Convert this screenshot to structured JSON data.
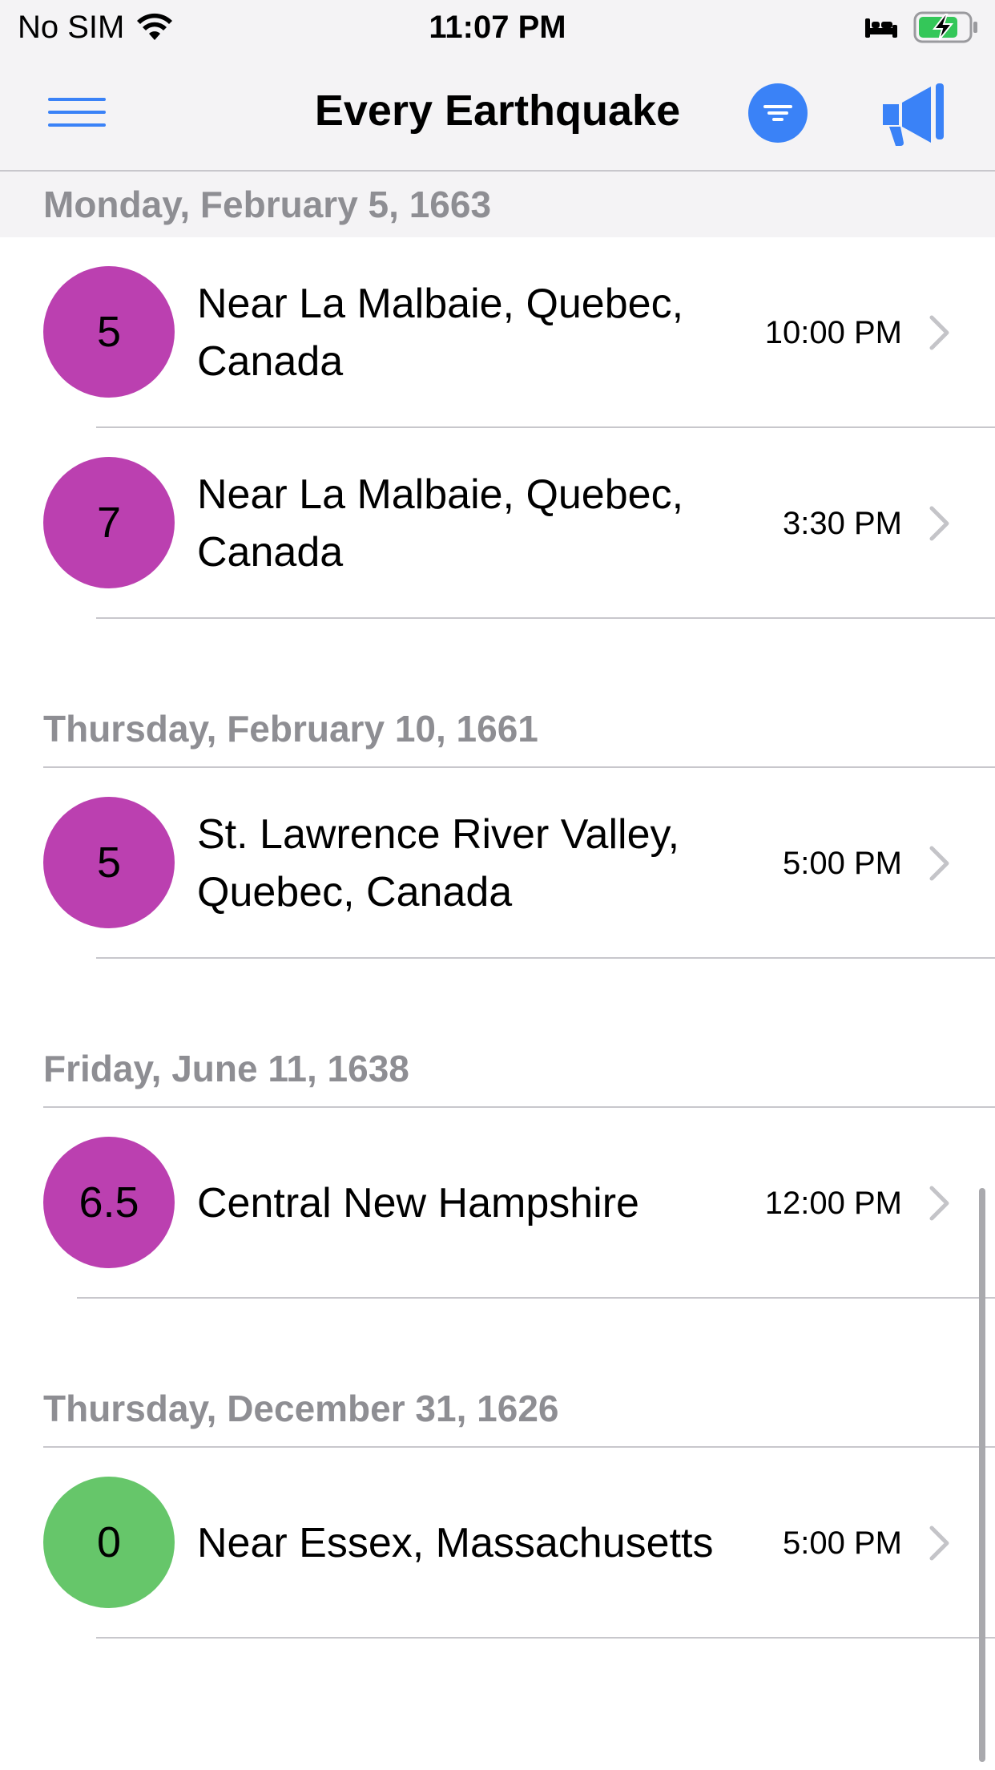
{
  "status_bar": {
    "carrier": "No SIM",
    "time": "11:07 PM"
  },
  "nav": {
    "title": "Every Earthquake",
    "accent_color": "#3a82f7"
  },
  "sections": [
    {
      "date": "Monday, February 5, 1663",
      "items": [
        {
          "magnitude": "5",
          "place": "Near La Malbaie, Quebec, Canada",
          "time": "10:00 PM"
        },
        {
          "magnitude": "7",
          "place": "Near La Malbaie, Quebec, Canada",
          "time": "3:30 PM"
        }
      ]
    },
    {
      "date": "Thursday, February 10, 1661",
      "items": [
        {
          "magnitude": "5",
          "place": "St. Lawrence River Valley, Quebec, Canada",
          "time": "5:00 PM"
        }
      ]
    },
    {
      "date": "Friday, June 11, 1638",
      "items": [
        {
          "magnitude": "6.5",
          "place": "Central New Hampshire",
          "time": "12:00 PM"
        }
      ]
    },
    {
      "date": "Thursday, December 31, 1626",
      "items": [
        {
          "magnitude": "0",
          "place": "Near Essex, Massachusetts",
          "time": "5:00 PM"
        }
      ]
    }
  ],
  "colors": {
    "magnitude_high": "#bb40b0",
    "magnitude_low": "#66c66a"
  }
}
